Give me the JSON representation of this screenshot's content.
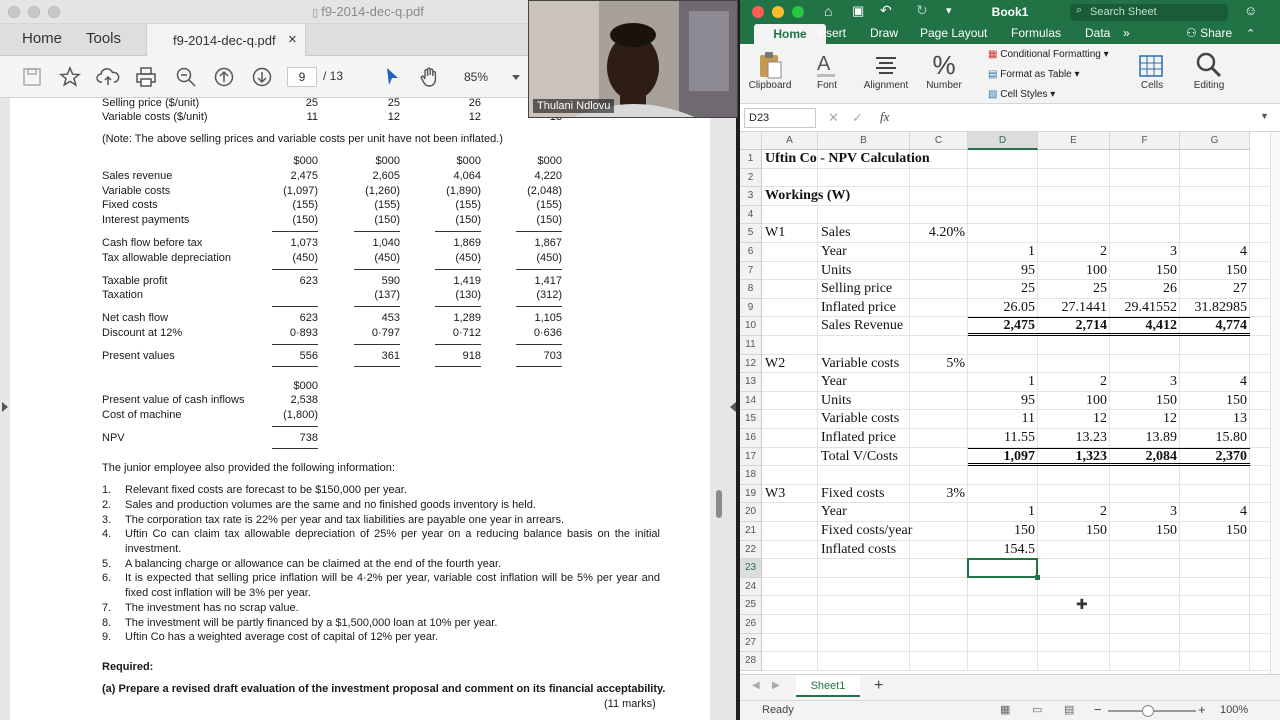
{
  "pdf": {
    "title": "f9-2014-dec-q.pdf",
    "tabs": {
      "home": "Home",
      "tools": "Tools",
      "document": "f9-2014-dec-q.pdf",
      "close": "×"
    },
    "toolbar": {
      "page_current": "9",
      "page_total": "/ 13",
      "zoom": "85%"
    },
    "table": {
      "price_rows": [
        {
          "label": "Selling price ($/unit)",
          "v": [
            "25",
            "25",
            "26",
            "27"
          ]
        },
        {
          "label": "Variable costs ($/unit)",
          "v": [
            "11",
            "12",
            "12",
            "13"
          ]
        }
      ],
      "note": "(Note: The above selling prices and variable costs per unit have not been inflated.)",
      "header": [
        "$000",
        "$000",
        "$000",
        "$000"
      ],
      "rows": [
        {
          "label": "Sales revenue",
          "v": [
            "2,475",
            "2,605",
            "4,064",
            "4,220"
          ]
        },
        {
          "label": "Variable costs",
          "v": [
            "(1,097)",
            "(1,260)",
            "(1,890)",
            "(2,048)"
          ]
        },
        {
          "label": "Fixed costs",
          "v": [
            "(155)",
            "(155)",
            "(155)",
            "(155)"
          ]
        },
        {
          "label": "Interest payments",
          "v": [
            "(150)",
            "(150)",
            "(150)",
            "(150)"
          ]
        },
        {
          "label": "Cash flow before tax",
          "v": [
            "1,073",
            "1,040",
            "1,869",
            "1,867"
          ]
        },
        {
          "label": "Tax allowable depreciation",
          "v": [
            "(450)",
            "(450)",
            "(450)",
            "(450)"
          ]
        },
        {
          "label": "Taxable profit",
          "v": [
            "623",
            "590",
            "1,419",
            "1,417"
          ]
        },
        {
          "label": "Taxation",
          "v": [
            "",
            "(137)",
            "(130)",
            "(312)"
          ]
        },
        {
          "label": "Net cash flow",
          "v": [
            "623",
            "453",
            "1,289",
            "1,105"
          ]
        },
        {
          "label": "Discount at 12%",
          "v": [
            "0·893",
            "0·797",
            "0·712",
            "0·636"
          ]
        },
        {
          "label": "Present values",
          "v": [
            "556",
            "361",
            "918",
            "703"
          ]
        }
      ],
      "summary_header": "$000",
      "summary": [
        {
          "label": "Present value of cash inflows",
          "v": "2,538"
        },
        {
          "label": "Cost of machine",
          "v": "(1,800)"
        },
        {
          "label": "NPV",
          "v": "738"
        }
      ]
    },
    "intro": "The junior employee also provided the following information:",
    "list": [
      {
        "n": "1.",
        "t": "Relevant fixed costs are forecast to be $150,000 per year."
      },
      {
        "n": "2.",
        "t": "Sales and production volumes are the same and no finished goods inventory is held."
      },
      {
        "n": "3.",
        "t": "The corporation tax rate is 22% per year and tax liabilities are payable one year in arrears."
      },
      {
        "n": "4.",
        "t": "Uftin Co can claim tax allowable depreciation of 25% per year on a reducing balance basis on the initial investment."
      },
      {
        "n": "5.",
        "t": "A balancing charge or allowance can be claimed at the end of the fourth year."
      },
      {
        "n": "6.",
        "t": "It is expected that selling price inflation will be 4·2% per year, variable cost inflation will be 5% per year and fixed cost inflation will be 3% per year."
      },
      {
        "n": "7.",
        "t": "The investment has no scrap value."
      },
      {
        "n": "8.",
        "t": "The investment will be partly financed by a $1,500,000 loan at 10% per year."
      },
      {
        "n": "9.",
        "t": "Uftin Co has a weighted average cost of capital of 12% per year."
      }
    ],
    "required": "Required:",
    "question_a": "(a)  Prepare a revised draft evaluation of the investment proposal and comment on its financial acceptability.",
    "marks": "(11 marks)"
  },
  "webcam": {
    "name": "Thulani Ndlovu"
  },
  "excel": {
    "title": "Book1",
    "search_placeholder": "Search Sheet",
    "tabs": [
      "Home",
      "Insert",
      "Draw",
      "Page Layout",
      "Formulas",
      "Data"
    ],
    "more_tabs": "»",
    "share": "Share",
    "ribbon": {
      "clipboard": "Clipboard",
      "font": "Font",
      "alignment": "Alignment",
      "number": "Number",
      "conditional_formatting": "Conditional Formatting",
      "format_as_table": "Format as Table",
      "cell_styles": "Cell Styles",
      "cells": "Cells",
      "editing": "Editing"
    },
    "name_box": "D23",
    "fx": "fx",
    "columns": [
      "A",
      "B",
      "C",
      "D",
      "E",
      "F",
      "G"
    ],
    "rows": [
      "1",
      "2",
      "3",
      "4",
      "5",
      "6",
      "7",
      "8",
      "9",
      "10",
      "11",
      "12",
      "13",
      "14",
      "15",
      "16",
      "17",
      "18",
      "19",
      "20",
      "21",
      "22",
      "23",
      "24",
      "25",
      "26",
      "27",
      "28"
    ],
    "cells": {
      "r1": {
        "a": "Uftin Co - NPV Calculation"
      },
      "r3": {
        "a": "Workings (W)"
      },
      "r5": {
        "a": "W1",
        "b": "Sales",
        "c": "4.20%"
      },
      "r6": {
        "b": "Year",
        "d": "1",
        "e": "2",
        "f": "3",
        "g": "4"
      },
      "r7": {
        "b": "Units",
        "d": "95",
        "e": "100",
        "f": "150",
        "g": "150"
      },
      "r8": {
        "b": "Selling price",
        "d": "25",
        "e": "25",
        "f": "26",
        "g": "27"
      },
      "r9": {
        "b": "Inflated price",
        "d": "26.05",
        "e": "27.1441",
        "f": "29.41552",
        "g": "31.82985"
      },
      "r10": {
        "b": "Sales Revenue",
        "d": "2,475",
        "e": "2,714",
        "f": "4,412",
        "g": "4,774"
      },
      "r12": {
        "a": "W2",
        "b": "Variable costs",
        "c": "5%"
      },
      "r13": {
        "b": "Year",
        "d": "1",
        "e": "2",
        "f": "3",
        "g": "4"
      },
      "r14": {
        "b": "Units",
        "d": "95",
        "e": "100",
        "f": "150",
        "g": "150"
      },
      "r15": {
        "b": "Variable costs",
        "d": "11",
        "e": "12",
        "f": "12",
        "g": "13"
      },
      "r16": {
        "b": "Inflated price",
        "d": "11.55",
        "e": "13.23",
        "f": "13.89",
        "g": "15.80"
      },
      "r17": {
        "b": "Total V/Costs",
        "d": "1,097",
        "e": "1,323",
        "f": "2,084",
        "g": "2,370"
      },
      "r19": {
        "a": "W3",
        "b": "Fixed costs",
        "c": "3%"
      },
      "r20": {
        "b": "Year",
        "d": "1",
        "e": "2",
        "f": "3",
        "g": "4"
      },
      "r21": {
        "b": "Fixed costs/year",
        "d": "150",
        "e": "150",
        "f": "150",
        "g": "150"
      },
      "r22": {
        "b": "Inflated costs",
        "d": "154.5"
      }
    },
    "sheet_tab": "Sheet1",
    "add_sheet": "+",
    "status": "Ready",
    "zoom": "100%",
    "colors": {
      "accent": "#217346"
    }
  }
}
